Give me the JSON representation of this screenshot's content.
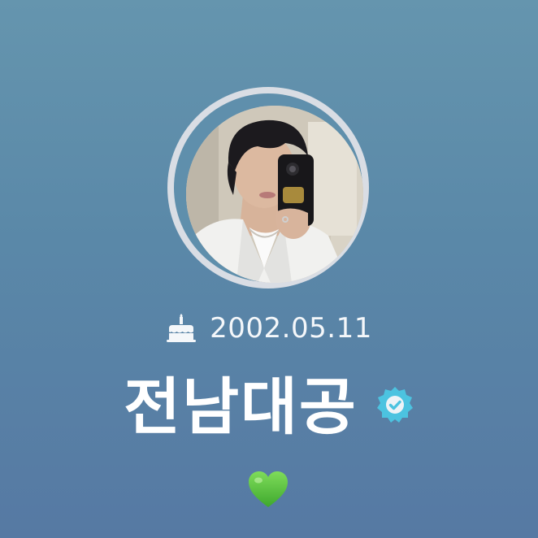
{
  "profile": {
    "birthday_icon": "cake-icon",
    "birthday": "2002.05.11",
    "name": "전남대공",
    "verified_icon": "verified-badge-icon",
    "status_emoji": "💚"
  },
  "colors": {
    "background_top": "#6595ae",
    "background_bottom": "#5679a3",
    "ring": "#d9dde4",
    "verified": "#4cc3e0",
    "heart": "#4fbf3a"
  }
}
